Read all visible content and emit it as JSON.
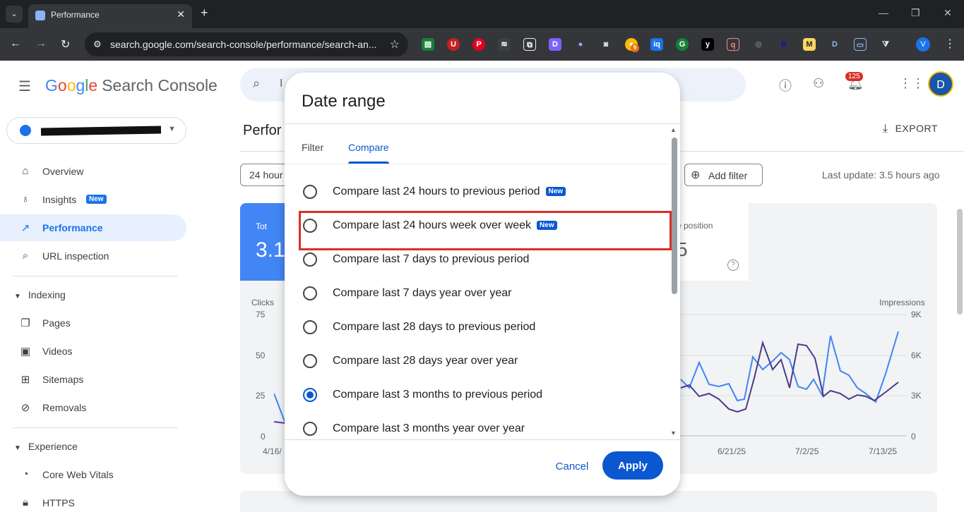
{
  "browser": {
    "tab_title": "Performance",
    "url": "search.google.com/search-console/performance/search-an...",
    "profile_initial": "V"
  },
  "header": {
    "logo_google": [
      "G",
      "o",
      "o",
      "g",
      "l",
      "e"
    ],
    "logo_product": "Search Console",
    "search_partial": "I",
    "notification_count": "125",
    "avatar_initial": "D"
  },
  "sidebar": {
    "items": [
      {
        "label": "Overview",
        "icon": "home-icon"
      },
      {
        "label": "Insights",
        "icon": "lightbulb-icon",
        "badge": "New"
      },
      {
        "label": "Performance",
        "icon": "trending-up-icon",
        "active": true
      },
      {
        "label": "URL inspection",
        "icon": "search-icon"
      }
    ],
    "indexing": {
      "heading": "Indexing",
      "items": [
        {
          "label": "Pages",
          "icon": "pages-icon"
        },
        {
          "label": "Videos",
          "icon": "video-icon"
        },
        {
          "label": "Sitemaps",
          "icon": "sitemap-icon"
        },
        {
          "label": "Removals",
          "icon": "visibility-off-icon"
        }
      ]
    },
    "experience": {
      "heading": "Experience",
      "items": [
        {
          "label": "Core Web Vitals",
          "icon": "speed-icon"
        },
        {
          "label": "HTTPS",
          "icon": "lock-icon"
        }
      ]
    }
  },
  "main": {
    "page_title_partial": "Perfor",
    "export_label": "EXPORT",
    "date_chip_partial": "24 hour",
    "add_filter_label": "Add filter",
    "last_update": "Last update: 3.5 hours ago",
    "metric_clicks_partial": "Tot",
    "metric_clicks_value_partial": "3.1",
    "metric_position_partial": "e position",
    "metric_position_value_partial": "5",
    "chart": {
      "left_axis_label": "Clicks",
      "right_axis_label": "Impressions",
      "left_ticks": [
        "75",
        "50",
        "25",
        "0"
      ],
      "right_ticks": [
        "9K",
        "6K",
        "3K",
        "0"
      ],
      "x_ticks": [
        "4/16/",
        "6/21/25",
        "7/2/25",
        "7/13/25"
      ]
    }
  },
  "dialog": {
    "title": "Date range",
    "tabs": [
      "Filter",
      "Compare"
    ],
    "active_tab": "Compare",
    "options": [
      {
        "label": "Compare last 24 hours to previous period",
        "badge": "New",
        "checked": false
      },
      {
        "label": "Compare last 24 hours week over week",
        "badge": "New",
        "checked": false
      },
      {
        "label": "Compare last 7 days to previous period",
        "checked": false
      },
      {
        "label": "Compare last 7 days year over year",
        "checked": false
      },
      {
        "label": "Compare last 28 days to previous period",
        "checked": false
      },
      {
        "label": "Compare last 28 days year over year",
        "checked": false
      },
      {
        "label": "Compare last 3 months to previous period",
        "checked": true
      },
      {
        "label": "Compare last 3 months year over year",
        "checked": false
      }
    ],
    "cancel_label": "Cancel",
    "apply_label": "Apply"
  },
  "colors": {
    "accent": "#0b57d0",
    "highlight_box": "#d93025",
    "clicks_metric": "#4285f4"
  }
}
